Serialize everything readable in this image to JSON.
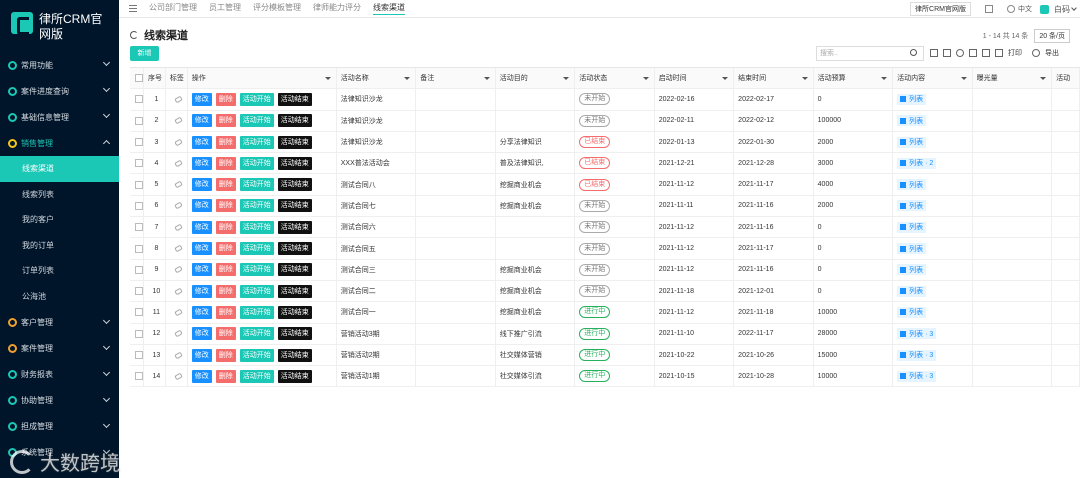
{
  "app": {
    "title": "律所CRM官网版"
  },
  "sidebar": {
    "menus": [
      {
        "label": "常用功能",
        "icon": "star-icon"
      },
      {
        "label": "案件进度查询",
        "icon": "search-circle-icon"
      },
      {
        "label": "基础信息管理",
        "icon": "doc-icon"
      },
      {
        "label": "销售管理",
        "icon": "sales-icon"
      }
    ],
    "sub_items": [
      "线索渠道",
      "线索列表",
      "我的客户",
      "我的订单",
      "订单列表",
      "公海池"
    ],
    "menus_bottom": [
      {
        "label": "客户管理",
        "icon": "customer-icon"
      },
      {
        "label": "案件管理",
        "icon": "case-icon"
      },
      {
        "label": "财务报表",
        "icon": "finance-icon"
      },
      {
        "label": "协助管理",
        "icon": "assist-icon"
      },
      {
        "label": "担成管理",
        "icon": "share-icon"
      },
      {
        "label": "系统管理",
        "icon": "system-icon"
      }
    ]
  },
  "topbar": {
    "tabs": [
      "公司部门管理",
      "员工管理",
      "评分模板管理",
      "律师能力评分",
      "线索渠道"
    ],
    "site_button": "律所CRM官网版",
    "lang": "中文",
    "user": "白码"
  },
  "page": {
    "title": "线索渠道",
    "pager_text": "1 - 14 共 14 条",
    "page_size": "20 条/页",
    "add_label": "新增",
    "search_placeholder": "搜索..",
    "print_label": "打印",
    "export_label": "导出"
  },
  "table": {
    "headers": [
      "序号",
      "标签",
      "操作",
      "活动名称",
      "备注",
      "活动目的",
      "活动状态",
      "启动时间",
      "结束时间",
      "活动预算",
      "活动内容",
      "曝光量",
      "活动"
    ],
    "action_labels": {
      "edit": "修改",
      "delete": "删除",
      "start": "活动开始",
      "end": "活动结束"
    },
    "rows": [
      {
        "no": "1",
        "name": "法律知识沙龙",
        "note": "",
        "purpose": "",
        "status": "未开始",
        "status_type": "gray",
        "start": "2022-02-16",
        "end": "2022-02-17",
        "budget": "0",
        "content": "列表",
        "count": ""
      },
      {
        "no": "2",
        "name": "法律知识沙龙",
        "note": "",
        "purpose": "",
        "status": "未开始",
        "status_type": "gray",
        "start": "2022-02-11",
        "end": "2022-02-12",
        "budget": "100000",
        "content": "列表",
        "count": ""
      },
      {
        "no": "3",
        "name": "法律知识沙龙",
        "note": "",
        "purpose": "分享法律知识",
        "status": "已结束",
        "status_type": "red",
        "start": "2022-01-13",
        "end": "2022-01-30",
        "budget": "2000",
        "content": "列表",
        "count": ""
      },
      {
        "no": "4",
        "name": "XXX普法活动会",
        "note": "",
        "purpose": "普及法律知识,",
        "status": "已结束",
        "status_type": "red",
        "start": "2021-12-21",
        "end": "2021-12-28",
        "budget": "3000",
        "content": "列表",
        "count": "2"
      },
      {
        "no": "5",
        "name": "测试合同八",
        "note": "",
        "purpose": "挖掘商业机会",
        "status": "已结束",
        "status_type": "red",
        "start": "2021-11-12",
        "end": "2021-11-17",
        "budget": "4000",
        "content": "列表",
        "count": ""
      },
      {
        "no": "6",
        "name": "测试合同七",
        "note": "",
        "purpose": "挖掘商业机会",
        "status": "未开始",
        "status_type": "gray",
        "start": "2021-11-11",
        "end": "2021-11-16",
        "budget": "2000",
        "content": "列表",
        "count": ""
      },
      {
        "no": "7",
        "name": "测试合同六",
        "note": "",
        "purpose": "",
        "status": "未开始",
        "status_type": "gray",
        "start": "2021-11-12",
        "end": "2021-11-16",
        "budget": "0",
        "content": "列表",
        "count": ""
      },
      {
        "no": "8",
        "name": "测试合同五",
        "note": "",
        "purpose": "",
        "status": "未开始",
        "status_type": "gray",
        "start": "2021-11-12",
        "end": "2021-11-17",
        "budget": "0",
        "content": "列表",
        "count": ""
      },
      {
        "no": "9",
        "name": "测试合同三",
        "note": "",
        "purpose": "挖掘商业机会",
        "status": "未开始",
        "status_type": "gray",
        "start": "2021-11-12",
        "end": "2021-11-16",
        "budget": "0",
        "content": "列表",
        "count": ""
      },
      {
        "no": "10",
        "name": "测试合同二",
        "note": "",
        "purpose": "挖掘商业机会",
        "status": "未开始",
        "status_type": "gray",
        "start": "2021-11-18",
        "end": "2021-12-01",
        "budget": "0",
        "content": "列表",
        "count": ""
      },
      {
        "no": "11",
        "name": "测试合同一",
        "note": "",
        "purpose": "挖掘商业机会",
        "status": "进行中",
        "status_type": "green",
        "start": "2021-11-12",
        "end": "2021-11-18",
        "budget": "10000",
        "content": "列表",
        "count": ""
      },
      {
        "no": "12",
        "name": "营销活动3期",
        "note": "",
        "purpose": "线下推广引流",
        "status": "进行中",
        "status_type": "green",
        "start": "2021-11-10",
        "end": "2022-11-17",
        "budget": "28000",
        "content": "列表",
        "count": "3"
      },
      {
        "no": "13",
        "name": "营销活动2期",
        "note": "",
        "purpose": "社交媒体营销",
        "status": "进行中",
        "status_type": "green",
        "start": "2021-10-22",
        "end": "2021-10-26",
        "budget": "15000",
        "content": "列表",
        "count": "3"
      },
      {
        "no": "14",
        "name": "营销活动1期",
        "note": "",
        "purpose": "社交媒体引流",
        "status": "进行中",
        "status_type": "green",
        "start": "2021-10-15",
        "end": "2021-10-28",
        "budget": "10000",
        "content": "列表",
        "count": "3"
      }
    ]
  },
  "watermark": "大数跨境",
  "colors": {
    "accent": "#1bc7b5",
    "sidebar": "#001529",
    "edit": "#1890ff",
    "delete": "#f56c6c",
    "end": "#111111"
  }
}
